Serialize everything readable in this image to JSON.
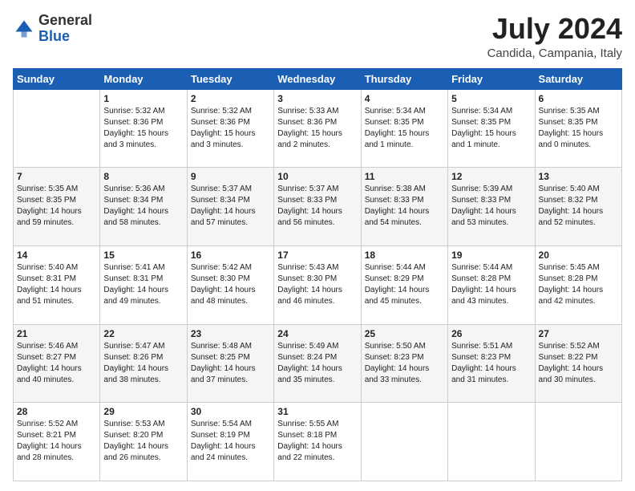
{
  "logo": {
    "general": "General",
    "blue": "Blue"
  },
  "header": {
    "month_year": "July 2024",
    "location": "Candida, Campania, Italy"
  },
  "days_of_week": [
    "Sunday",
    "Monday",
    "Tuesday",
    "Wednesday",
    "Thursday",
    "Friday",
    "Saturday"
  ],
  "weeks": [
    [
      {
        "day": "",
        "content": ""
      },
      {
        "day": "1",
        "content": "Sunrise: 5:32 AM\nSunset: 8:36 PM\nDaylight: 15 hours\nand 3 minutes."
      },
      {
        "day": "2",
        "content": "Sunrise: 5:32 AM\nSunset: 8:36 PM\nDaylight: 15 hours\nand 3 minutes."
      },
      {
        "day": "3",
        "content": "Sunrise: 5:33 AM\nSunset: 8:36 PM\nDaylight: 15 hours\nand 2 minutes."
      },
      {
        "day": "4",
        "content": "Sunrise: 5:34 AM\nSunset: 8:35 PM\nDaylight: 15 hours\nand 1 minute."
      },
      {
        "day": "5",
        "content": "Sunrise: 5:34 AM\nSunset: 8:35 PM\nDaylight: 15 hours\nand 1 minute."
      },
      {
        "day": "6",
        "content": "Sunrise: 5:35 AM\nSunset: 8:35 PM\nDaylight: 15 hours\nand 0 minutes."
      }
    ],
    [
      {
        "day": "7",
        "content": "Sunrise: 5:35 AM\nSunset: 8:35 PM\nDaylight: 14 hours\nand 59 minutes."
      },
      {
        "day": "8",
        "content": "Sunrise: 5:36 AM\nSunset: 8:34 PM\nDaylight: 14 hours\nand 58 minutes."
      },
      {
        "day": "9",
        "content": "Sunrise: 5:37 AM\nSunset: 8:34 PM\nDaylight: 14 hours\nand 57 minutes."
      },
      {
        "day": "10",
        "content": "Sunrise: 5:37 AM\nSunset: 8:33 PM\nDaylight: 14 hours\nand 56 minutes."
      },
      {
        "day": "11",
        "content": "Sunrise: 5:38 AM\nSunset: 8:33 PM\nDaylight: 14 hours\nand 54 minutes."
      },
      {
        "day": "12",
        "content": "Sunrise: 5:39 AM\nSunset: 8:33 PM\nDaylight: 14 hours\nand 53 minutes."
      },
      {
        "day": "13",
        "content": "Sunrise: 5:40 AM\nSunset: 8:32 PM\nDaylight: 14 hours\nand 52 minutes."
      }
    ],
    [
      {
        "day": "14",
        "content": "Sunrise: 5:40 AM\nSunset: 8:31 PM\nDaylight: 14 hours\nand 51 minutes."
      },
      {
        "day": "15",
        "content": "Sunrise: 5:41 AM\nSunset: 8:31 PM\nDaylight: 14 hours\nand 49 minutes."
      },
      {
        "day": "16",
        "content": "Sunrise: 5:42 AM\nSunset: 8:30 PM\nDaylight: 14 hours\nand 48 minutes."
      },
      {
        "day": "17",
        "content": "Sunrise: 5:43 AM\nSunset: 8:30 PM\nDaylight: 14 hours\nand 46 minutes."
      },
      {
        "day": "18",
        "content": "Sunrise: 5:44 AM\nSunset: 8:29 PM\nDaylight: 14 hours\nand 45 minutes."
      },
      {
        "day": "19",
        "content": "Sunrise: 5:44 AM\nSunset: 8:28 PM\nDaylight: 14 hours\nand 43 minutes."
      },
      {
        "day": "20",
        "content": "Sunrise: 5:45 AM\nSunset: 8:28 PM\nDaylight: 14 hours\nand 42 minutes."
      }
    ],
    [
      {
        "day": "21",
        "content": "Sunrise: 5:46 AM\nSunset: 8:27 PM\nDaylight: 14 hours\nand 40 minutes."
      },
      {
        "day": "22",
        "content": "Sunrise: 5:47 AM\nSunset: 8:26 PM\nDaylight: 14 hours\nand 38 minutes."
      },
      {
        "day": "23",
        "content": "Sunrise: 5:48 AM\nSunset: 8:25 PM\nDaylight: 14 hours\nand 37 minutes."
      },
      {
        "day": "24",
        "content": "Sunrise: 5:49 AM\nSunset: 8:24 PM\nDaylight: 14 hours\nand 35 minutes."
      },
      {
        "day": "25",
        "content": "Sunrise: 5:50 AM\nSunset: 8:23 PM\nDaylight: 14 hours\nand 33 minutes."
      },
      {
        "day": "26",
        "content": "Sunrise: 5:51 AM\nSunset: 8:23 PM\nDaylight: 14 hours\nand 31 minutes."
      },
      {
        "day": "27",
        "content": "Sunrise: 5:52 AM\nSunset: 8:22 PM\nDaylight: 14 hours\nand 30 minutes."
      }
    ],
    [
      {
        "day": "28",
        "content": "Sunrise: 5:52 AM\nSunset: 8:21 PM\nDaylight: 14 hours\nand 28 minutes."
      },
      {
        "day": "29",
        "content": "Sunrise: 5:53 AM\nSunset: 8:20 PM\nDaylight: 14 hours\nand 26 minutes."
      },
      {
        "day": "30",
        "content": "Sunrise: 5:54 AM\nSunset: 8:19 PM\nDaylight: 14 hours\nand 24 minutes."
      },
      {
        "day": "31",
        "content": "Sunrise: 5:55 AM\nSunset: 8:18 PM\nDaylight: 14 hours\nand 22 minutes."
      },
      {
        "day": "",
        "content": ""
      },
      {
        "day": "",
        "content": ""
      },
      {
        "day": "",
        "content": ""
      }
    ]
  ]
}
